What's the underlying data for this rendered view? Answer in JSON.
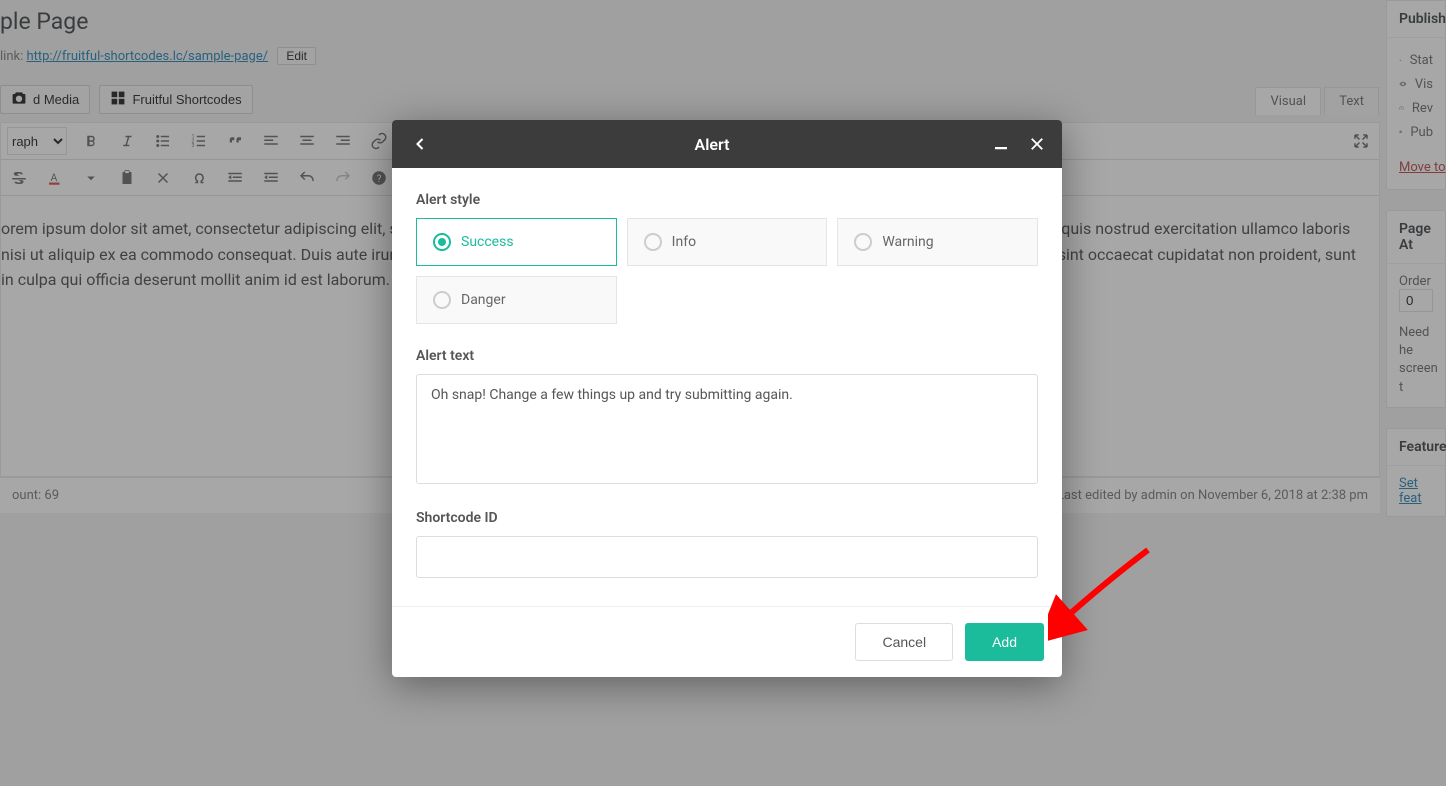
{
  "page": {
    "title": "ple Page",
    "permalink_label": "link:",
    "permalink_url": "http://fruitful-shortcodes.lc/sample-page/",
    "edit_label": "Edit"
  },
  "media": {
    "add_media_label": "d Media",
    "shortcodes_label": "Fruitful Shortcodes"
  },
  "tabs": {
    "visual": "Visual",
    "text": "Text"
  },
  "toolbar": {
    "format_select": "raph"
  },
  "content": {
    "text": "orem ipsum dolor sit amet, consectetur adipiscing elit, sed do eiusmod tempor incididunt ut labore et dolore magna aliqua. Ut enim ad minim veniam, quis nostrud exercitation ullamco laboris nisi ut aliquip ex ea commodo consequat. Duis aute irure dolor in reprehenderit in voluptate velit esse cillum dolore eu fugiat nulla pariatur. Excepteur sint occaecat cupidatat non proident, sunt in culpa qui officia deserunt mollit anim id est laborum."
  },
  "status": {
    "word_count": "ount: 69",
    "last_edited": "n. Last edited by admin on November 6, 2018 at 2:38 pm"
  },
  "sidebar": {
    "publish": {
      "title": "Publish",
      "status_label": "Stat",
      "visibility_label": "Vis",
      "revisions_label": "Rev",
      "published_label": "Pub",
      "move_trash": "Move to"
    },
    "page_attrs": {
      "title": "Page At",
      "order_label": "Order",
      "order_value": "0",
      "help_text": "Need he screen t"
    },
    "featured": {
      "title": "Feature",
      "set_link": "Set feat"
    }
  },
  "modal": {
    "title": "Alert",
    "field_style_label": "Alert style",
    "styles": {
      "success": "Success",
      "info": "Info",
      "warning": "Warning",
      "danger": "Danger"
    },
    "field_text_label": "Alert text",
    "text_value": "Oh snap! Change a few things up and try submitting again.",
    "field_id_label": "Shortcode ID",
    "id_value": "",
    "cancel_label": "Cancel",
    "add_label": "Add"
  }
}
